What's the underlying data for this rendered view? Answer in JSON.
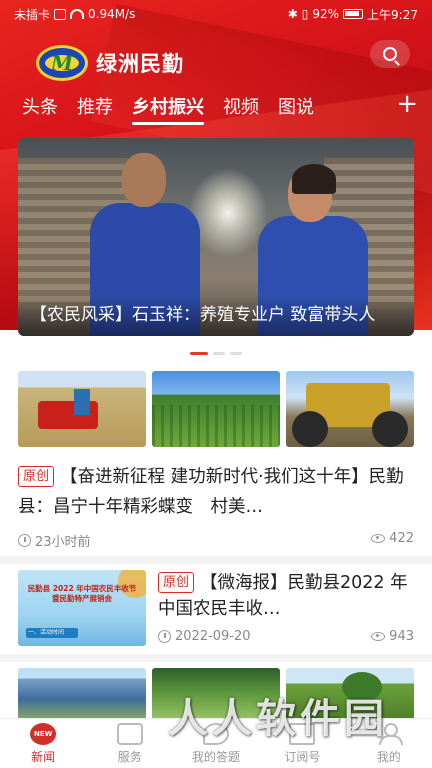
{
  "status_bar": {
    "sim": "未插卡",
    "speed": "0.94M/s",
    "battery": "92%",
    "time": "上午9:27"
  },
  "app": {
    "logo_letter": "M",
    "title": "绿洲民勤"
  },
  "tabs": [
    "头条",
    "推荐",
    "乡村振兴",
    "视频",
    "图说"
  ],
  "active_tab": "乡村振兴",
  "banner": {
    "caption": "【农民风采】石玉祥：养殖专业户 致富带头人"
  },
  "feed": {
    "item1": {
      "tag": "原创",
      "title": "【奋进新征程 建功新时代·我们这十年】民勤县：昌宁十年精彩蝶变　村美…",
      "time": "23小时前",
      "views": "422"
    },
    "item2": {
      "poster_text": "民勤县 2022 年中国农民丰收节暨民勤特产展销会",
      "poster_strip": "一、活动时间",
      "tag": "原创",
      "title": "【微海报】民勤县2022 年中国农民丰收…",
      "date": "2022-09-20",
      "views": "943"
    }
  },
  "bottom_nav": [
    "新闻",
    "服务",
    "我的答题",
    "订阅号",
    "我的"
  ],
  "news_icon_text": "NEW",
  "watermark": "人人软件园",
  "colors": {
    "brand_red": "#d1302a",
    "header_red": "#d6141a"
  }
}
